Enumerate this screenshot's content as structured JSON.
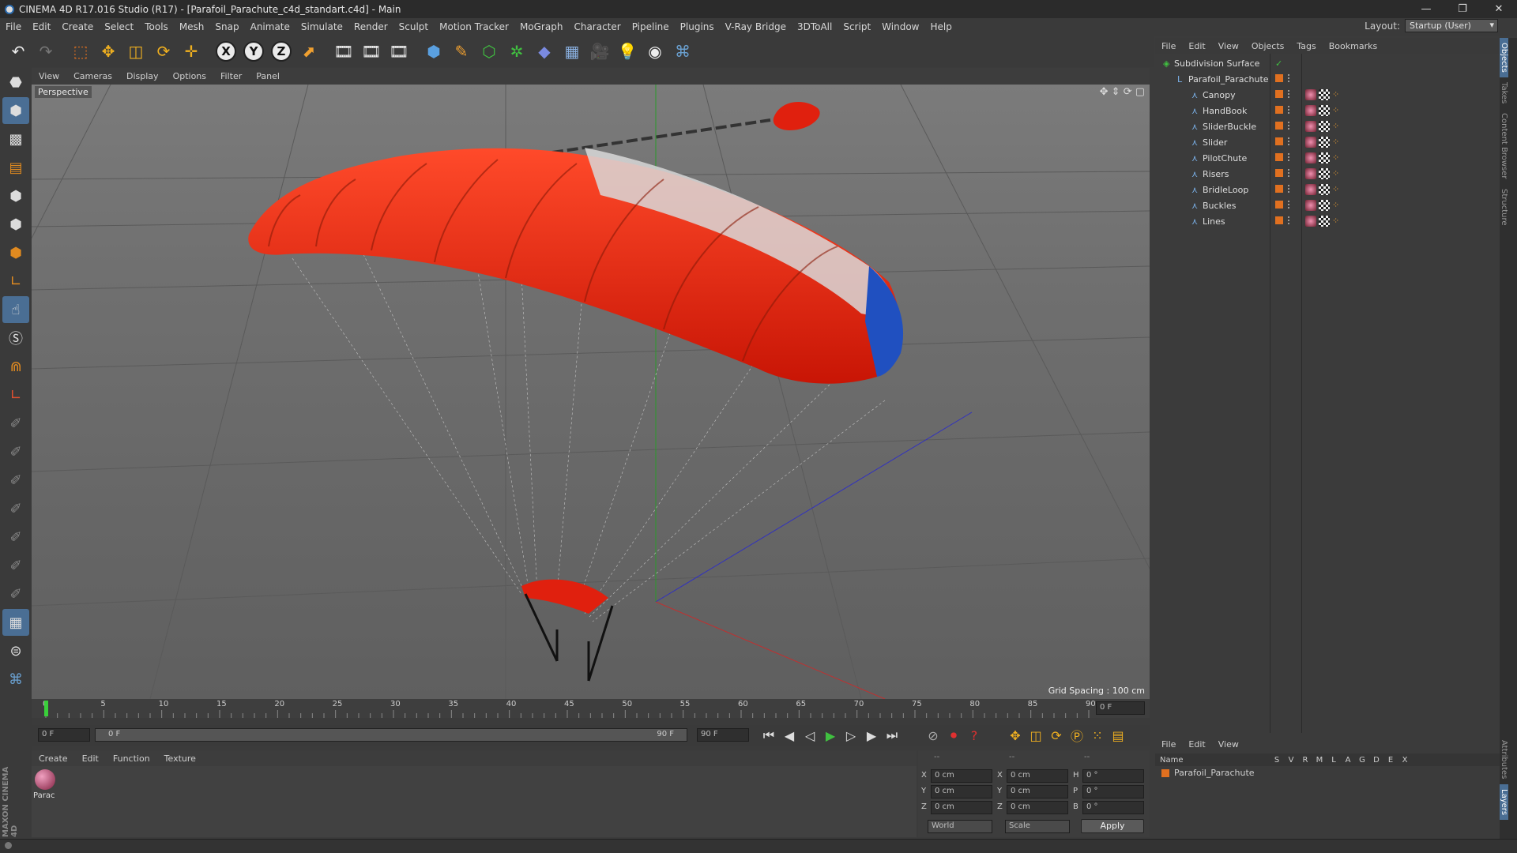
{
  "window": {
    "title": "CINEMA 4D R17.016 Studio (R17) - [Parafoil_Parachute_c4d_standart.c4d] - Main"
  },
  "menu": [
    "File",
    "Edit",
    "Create",
    "Select",
    "Tools",
    "Mesh",
    "Snap",
    "Animate",
    "Simulate",
    "Render",
    "Sculpt",
    "Motion Tracker",
    "MoGraph",
    "Character",
    "Pipeline",
    "Plugins",
    "V-Ray Bridge",
    "3DToAll",
    "Script",
    "Window",
    "Help"
  ],
  "layout": {
    "label": "Layout:",
    "value": "Startup (User)"
  },
  "viewport": {
    "menu": [
      "View",
      "Cameras",
      "Display",
      "Options",
      "Filter",
      "Panel"
    ],
    "label": "Perspective",
    "grid_spacing": "Grid Spacing : 100 cm"
  },
  "timeline": {
    "ticks": [
      "0",
      "5",
      "10",
      "15",
      "20",
      "25",
      "30",
      "35",
      "40",
      "45",
      "50",
      "55",
      "60",
      "65",
      "70",
      "75",
      "80",
      "85",
      "90"
    ],
    "frame_field": "0 F"
  },
  "transport": {
    "start": "0 F",
    "scrub_start": "0 F",
    "scrub_end": "90 F",
    "end": "90 F"
  },
  "material": {
    "menu": [
      "Create",
      "Edit",
      "Function",
      "Texture"
    ],
    "item": "Parac"
  },
  "coords": {
    "rows": [
      {
        "a": "X",
        "av": "0 cm",
        "b": "X",
        "bv": "0 cm",
        "c": "H",
        "cv": "0 °"
      },
      {
        "a": "Y",
        "av": "0 cm",
        "b": "Y",
        "bv": "0 cm",
        "c": "P",
        "cv": "0 °"
      },
      {
        "a": "Z",
        "av": "0 cm",
        "b": "Z",
        "bv": "0 cm",
        "c": "B",
        "cv": "0 °"
      }
    ],
    "mode1": "World",
    "mode2": "Scale",
    "apply": "Apply",
    "header1": "--",
    "header2": "--",
    "header3": "--"
  },
  "objects": {
    "menu": [
      "File",
      "Edit",
      "View",
      "Objects",
      "Tags",
      "Bookmarks"
    ],
    "items": [
      {
        "name": "Subdivision Surface",
        "level": 0
      },
      {
        "name": "Parafoil_Parachute",
        "level": 1
      },
      {
        "name": "Canopy",
        "level": 2
      },
      {
        "name": "HandBook",
        "level": 2
      },
      {
        "name": "SliderBuckle",
        "level": 2
      },
      {
        "name": "Slider",
        "level": 2
      },
      {
        "name": "PilotChute",
        "level": 2
      },
      {
        "name": "Risers",
        "level": 2
      },
      {
        "name": "BridleLoop",
        "level": 2
      },
      {
        "name": "Buckles",
        "level": 2
      },
      {
        "name": "Lines",
        "level": 2
      }
    ]
  },
  "layers": {
    "menu": [
      "File",
      "Edit",
      "View"
    ],
    "columns": [
      "Name",
      "S",
      "V",
      "R",
      "M",
      "L",
      "A",
      "G",
      "D",
      "E",
      "X"
    ],
    "row": "Parafoil_Parachute"
  },
  "sidetabs": [
    "Objects",
    "Takes",
    "Content Browser",
    "Structure"
  ],
  "sidetabs_bottom": [
    "Attributes",
    "Layers"
  ],
  "brand": "MAXON CINEMA 4D",
  "colors": {
    "accent": "#4a6e94",
    "canopy_red": "#e0200e",
    "orange": "#e07020"
  }
}
